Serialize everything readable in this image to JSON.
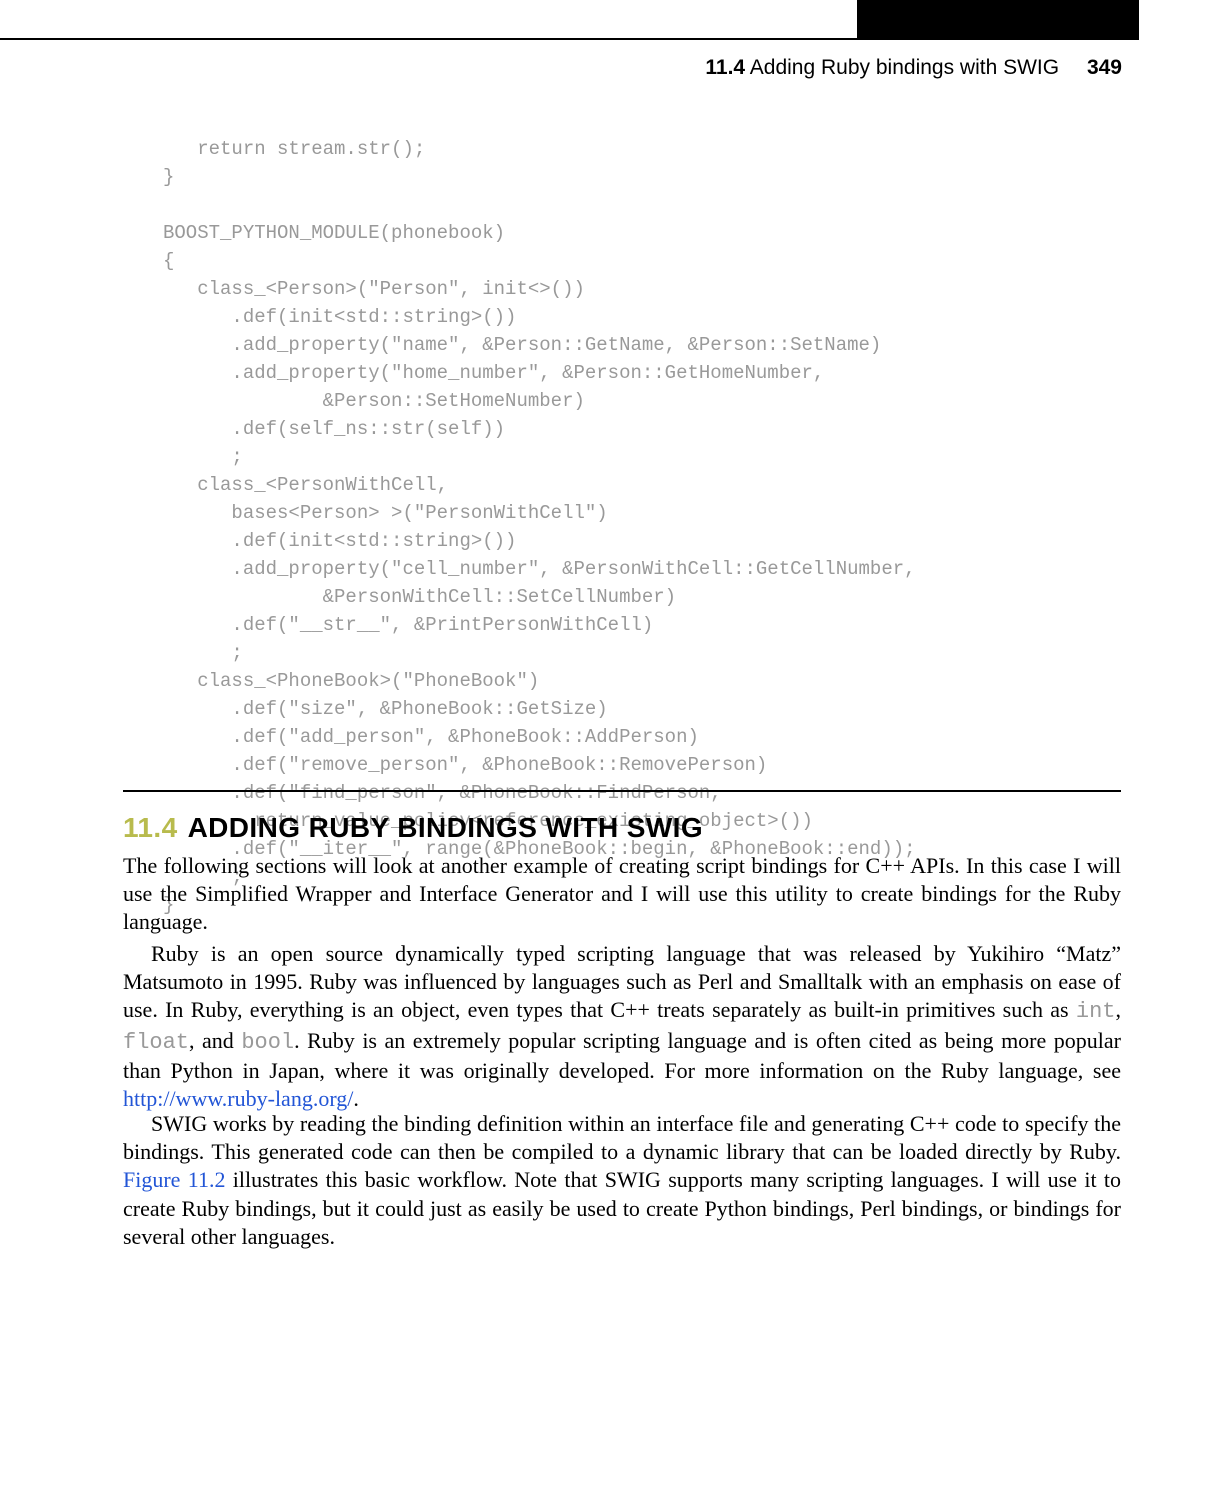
{
  "header": {
    "section_number": "11.4",
    "section_title": "Adding Ruby bindings with SWIG",
    "page_number": "349"
  },
  "code": {
    "lines": "   return stream.str();\n}\n\nBOOST_PYTHON_MODULE(phonebook)\n{\n   class_<Person>(\"Person\", init<>())\n      .def(init<std::string>())\n      .add_property(\"name\", &Person::GetName, &Person::SetName)\n      .add_property(\"home_number\", &Person::GetHomeNumber,\n              &Person::SetHomeNumber)\n      .def(self_ns::str(self))\n      ;\n   class_<PersonWithCell,\n      bases<Person> >(\"PersonWithCell\")\n      .def(init<std::string>())\n      .add_property(\"cell_number\", &PersonWithCell::GetCellNumber,\n              &PersonWithCell::SetCellNumber)\n      .def(\"__str__\", &PrintPersonWithCell)\n      ;\n   class_<PhoneBook>(\"PhoneBook\")\n      .def(\"size\", &PhoneBook::GetSize)\n      .def(\"add_person\", &PhoneBook::AddPerson)\n      .def(\"remove_person\", &PhoneBook::RemovePerson)\n      .def(\"find_person\", &PhoneBook::FindPerson,\n        return_value_policy<reference_existing_object>())\n      .def(\"__iter__\", range(&PhoneBook::begin, &PhoneBook::end));\n      ;\n}"
  },
  "section": {
    "number": "11.4",
    "title": "ADDING RUBY BINDINGS WITH SWIG"
  },
  "paragraphs": {
    "p1": "The following sections will look at another example of creating script bindings for C++ APIs. In this case I will use the Simplified Wrapper and Interface Generator and I will use this utility to create bindings for the Ruby language.",
    "p2a": "Ruby is an open source dynamically typed scripting language that was released by Yukihiro “Matz” Matsumoto in 1995. Ruby was influenced by languages such as Perl and Smalltalk with an emphasis on ease of use. In Ruby, everything is an object, even types that C++ treats separately as built-in primitives such as ",
    "p2_code1": "int",
    "p2b": ", ",
    "p2_code2": "float",
    "p2c": ", and ",
    "p2_code3": "bool",
    "p2d": ". Ruby is an extremely popular scripting language and is often cited as being more popular than Python in Japan, where it was originally developed. For more information on the Ruby language, see ",
    "p2_link": "http://www.ruby-lang.org/",
    "p2e": ".",
    "p3a": "SWIG works by reading the binding definition within an interface file and generating C++ code to specify the bindings. This generated code can then be compiled to a dynamic library that can be loaded directly by Ruby. ",
    "p3_link": "Figure 11.2",
    "p3b": " illustrates this basic workflow. Note that SWIG supports many scripting languages. I will use it to create Ruby bindings, but it could just as easily be used to create Python bindings, Perl bindings, or bindings for several other languages."
  }
}
